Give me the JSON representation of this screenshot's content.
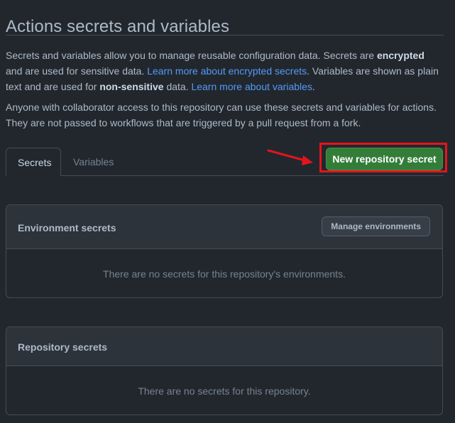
{
  "page": {
    "title": "Actions secrets and variables"
  },
  "description": {
    "p1_part1": "Secrets and variables allow you to manage reusable configuration data. Secrets are ",
    "p1_bold1": "encrypted",
    "p1_part2": " and are used for sensitive data. ",
    "p1_link1": "Learn more about encrypted secrets",
    "p1_part3": ". Variables are shown as plain text and are used for ",
    "p1_bold2": "non-sensitive",
    "p1_part4": " data. ",
    "p1_link2": "Learn more about variables",
    "p1_part5": ".",
    "p2": "Anyone with collaborator access to this repository can use these secrets and variables for actions. They are not passed to workflows that are triggered by a pull request from a fork."
  },
  "tabs": [
    {
      "label": "Secrets",
      "selected": true
    },
    {
      "label": "Variables",
      "selected": false
    }
  ],
  "actions": {
    "new_secret_label": "New repository secret"
  },
  "environment_secrets": {
    "title": "Environment secrets",
    "manage_label": "Manage environments",
    "empty_text": "There are no secrets for this repository's environments."
  },
  "repository_secrets": {
    "title": "Repository secrets",
    "empty_text": "There are no secrets for this repository."
  },
  "annotation": {
    "arrow_icon": "red-arrow-right",
    "highlight_color": "#e5141b"
  },
  "colors": {
    "background": "#22272e",
    "primary_button": "#347d39",
    "link": "#539bf5"
  }
}
